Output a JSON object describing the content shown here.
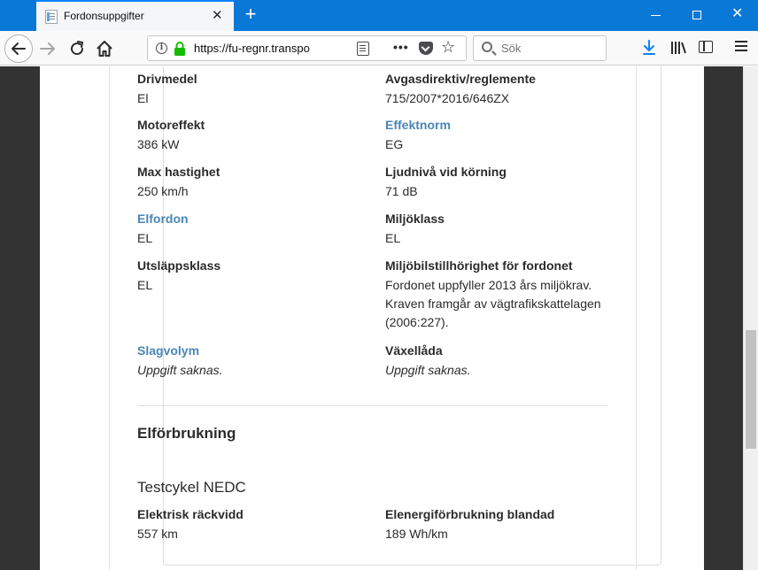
{
  "browser": {
    "tab_title": "Fordonsuppgifter",
    "tab_close": "✕",
    "new_tab": "+",
    "url": "https://fu-regnr.transpo",
    "search_placeholder": "Sök",
    "more": "•••"
  },
  "vehicle": {
    "fields": [
      {
        "label": "Drivmedel",
        "value": "El",
        "link": false,
        "italic": false
      },
      {
        "label": "Avgasdirektiv/reglemente",
        "value": "715/2007*2016/646ZX",
        "link": false,
        "italic": false
      },
      {
        "label": "Motoreffekt",
        "value": "386 kW",
        "link": false,
        "italic": false
      },
      {
        "label": "Effektnorm",
        "value": "EG",
        "link": true,
        "italic": false
      },
      {
        "label": "Max hastighet",
        "value": "250 km/h",
        "link": false,
        "italic": false
      },
      {
        "label": "Ljudnivå vid körning",
        "value": "71 dB",
        "link": false,
        "italic": false
      },
      {
        "label": "Elfordon",
        "value": "EL",
        "link": true,
        "italic": false
      },
      {
        "label": "Miljöklass",
        "value": "EL",
        "link": false,
        "italic": false
      },
      {
        "label": "Utsläppsklass",
        "value": "EL",
        "link": false,
        "italic": false
      },
      {
        "label": "Miljöbilstillhörighet för fordonet",
        "value_lines": [
          "Fordonet uppfyller 2013 års miljökrav.",
          "Kraven framgår av vägtrafikskattelagen",
          "(2006:227)."
        ],
        "link": false,
        "italic": false
      },
      {
        "label": "Slagvolym",
        "value": "Uppgift saknas.",
        "link": true,
        "italic": true
      },
      {
        "label": "Växellåda",
        "value": "Uppgift saknas.",
        "link": false,
        "italic": true
      }
    ]
  },
  "electric": {
    "section_title": "Elförbrukning",
    "subsection_title": "Testcykel NEDC",
    "fields": [
      {
        "label": "Elektrisk räckvidd",
        "value": "557 km"
      },
      {
        "label": "Elenergiförbrukning blandad",
        "value": "189 Wh/km"
      }
    ]
  }
}
